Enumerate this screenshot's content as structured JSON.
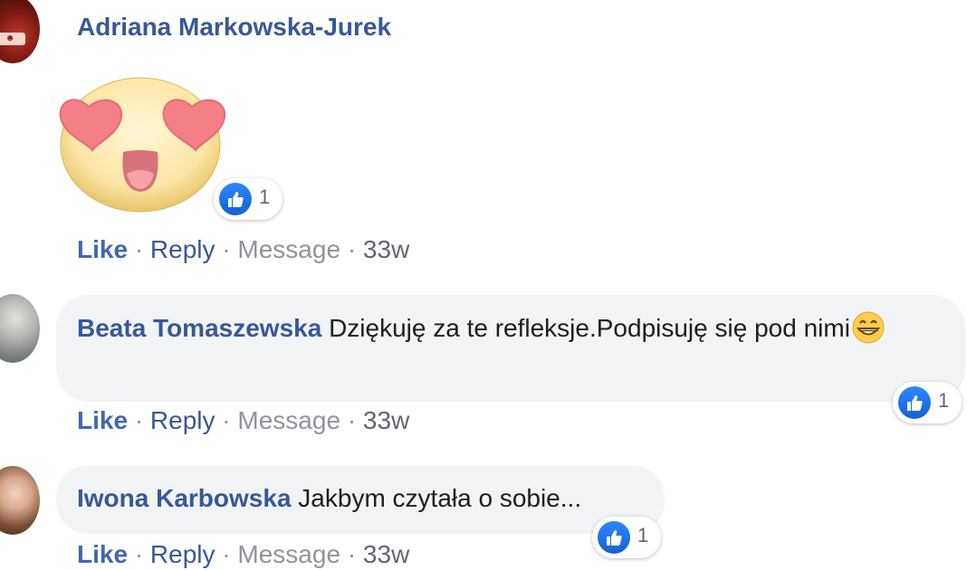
{
  "comments": [
    {
      "author": "Adriana Markowska-Jurek",
      "avatar_icon": "avatar-photo",
      "sticker_icon": "heart-eyes-emoji-sticker",
      "reaction_count": "1",
      "actions": {
        "like": "Like",
        "reply": "Reply",
        "message": "Message",
        "time": "33w",
        "separator": "·"
      }
    },
    {
      "author": "Beata Tomaszewska",
      "text": "Dziękuję za te refleksje.Podpisuję się pod nimi",
      "trailing_emoji_icon": "grinning-emoji",
      "reaction_count": "1",
      "actions": {
        "like": "Like",
        "reply": "Reply",
        "message": "Message",
        "time": "33w",
        "separator": "·"
      }
    },
    {
      "author": "Iwona Karbowska",
      "text": "Jakbym czytała o sobie...",
      "reaction_count": "1",
      "actions": {
        "like": "Like",
        "reply": "Reply",
        "message": "Message",
        "time": "33w",
        "separator": "·"
      }
    }
  ],
  "colors": {
    "link": "#385898",
    "like": "#4267b2",
    "bubble": "#f2f3f5",
    "meta": "#90949c",
    "reaction": "#2d88ff"
  }
}
